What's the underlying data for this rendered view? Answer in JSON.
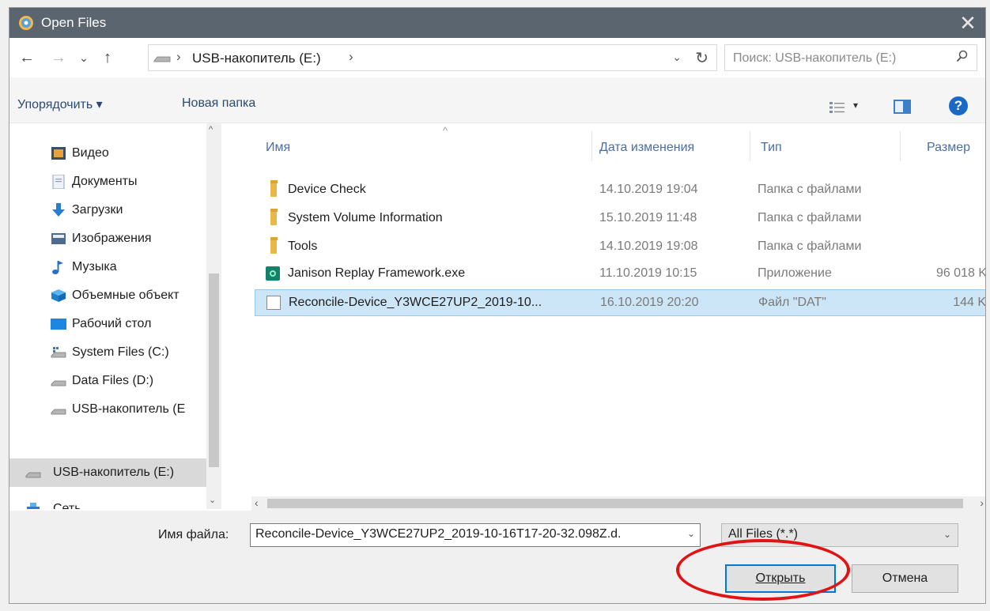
{
  "window": {
    "title": "Open Files",
    "close_glyph": "✕"
  },
  "nav": {
    "back_glyph": "←",
    "forward_glyph": "→",
    "recent_glyph": "⌄",
    "up_glyph": "↑",
    "separator_glyph": "›",
    "crumb": "USB-накопитель (E:)",
    "dropdown_glyph": "⌄",
    "refresh_glyph": "↻",
    "search_placeholder": "Поиск: USB-накопитель (E:)"
  },
  "toolbar": {
    "organize": "Упорядочить ▾",
    "new_folder": "Новая папка",
    "view_dd_glyph": "▾",
    "help_glyph": "?"
  },
  "sidebar": {
    "items": [
      {
        "label": "Видео",
        "icon": "video-icon"
      },
      {
        "label": "Документы",
        "icon": "documents-icon"
      },
      {
        "label": "Загрузки",
        "icon": "downloads-icon"
      },
      {
        "label": "Изображения",
        "icon": "pictures-icon"
      },
      {
        "label": "Музыка",
        "icon": "music-icon"
      },
      {
        "label": "Объемные объект",
        "icon": "3d-objects-icon"
      },
      {
        "label": "Рабочий стол",
        "icon": "desktop-icon"
      },
      {
        "label": "System Files (C:)",
        "icon": "system-drive-icon"
      },
      {
        "label": "Data Files (D:)",
        "icon": "drive-icon"
      },
      {
        "label": "USB-накопитель (E",
        "icon": "usb-drive-icon"
      },
      {
        "label": "USB-накопитель (E:)",
        "icon": "usb-drive-icon"
      },
      {
        "label": "Сеть",
        "icon": "network-icon"
      }
    ]
  },
  "columns": {
    "name": "Имя",
    "date": "Дата изменения",
    "type": "Тип",
    "size": "Размер",
    "sort_glyph": "^"
  },
  "files": [
    {
      "name": "Device Check",
      "date": "14.10.2019 19:04",
      "type": "Папка с файлами",
      "size": "",
      "icon": "folder-icon"
    },
    {
      "name": "System Volume Information",
      "date": "15.10.2019 11:48",
      "type": "Папка с файлами",
      "size": "",
      "icon": "folder-icon"
    },
    {
      "name": "Tools",
      "date": "14.10.2019 19:08",
      "type": "Папка с файлами",
      "size": "",
      "icon": "folder-icon"
    },
    {
      "name": "Janison Replay Framework.exe",
      "date": "11.10.2019 10:15",
      "type": "Приложение",
      "size": "96 018 K",
      "icon": "exe-icon"
    },
    {
      "name": "Reconcile-Device_Y3WCE27UP2_2019-10...",
      "date": "16.10.2019 20:20",
      "type": "Файл \"DAT\"",
      "size": "144 K",
      "icon": "file-icon"
    }
  ],
  "scroll": {
    "up": "^",
    "down": "⌄",
    "left": "‹",
    "right": "›"
  },
  "bottom": {
    "filename_label": "Имя файла:",
    "filename_value": "Reconcile-Device_Y3WCE27UP2_2019-10-16T17-20-32.098Z.d.",
    "filename_dd": "⌄",
    "filter_value": "All Files (*.*)",
    "filter_dd": "⌄",
    "open_button": "Открыть",
    "cancel_button": "Отмена"
  },
  "colors": {
    "selection": "#cce5f7",
    "accent": "#0078d7",
    "highlight_circle": "#e01414"
  }
}
